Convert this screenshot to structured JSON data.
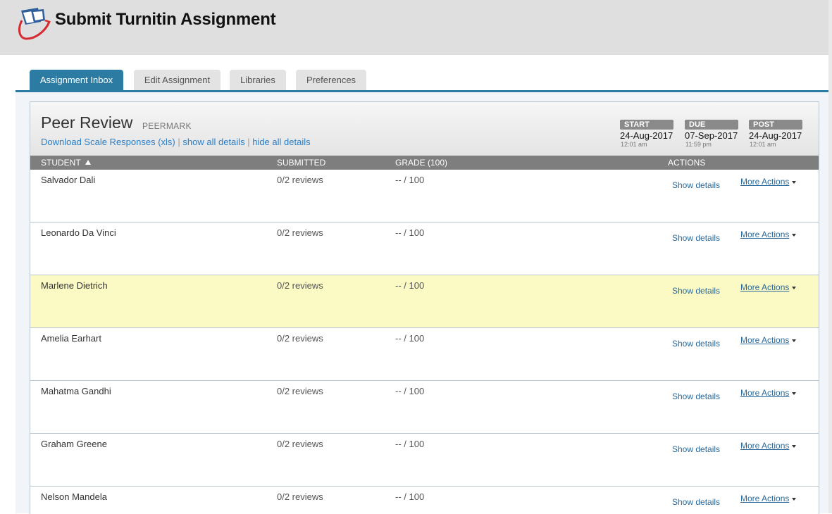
{
  "header": {
    "title": "Submit Turnitin Assignment",
    "logo_icon": "turnitin-logo-icon"
  },
  "tabs": [
    {
      "label": "Assignment Inbox",
      "active": true
    },
    {
      "label": "Edit Assignment",
      "active": false
    },
    {
      "label": "Libraries",
      "active": false
    },
    {
      "label": "Preferences",
      "active": false
    }
  ],
  "assignment": {
    "title": "Peer Review",
    "type": "PEERMARK",
    "links": {
      "download": "Download Scale Responses (xls)",
      "separator": "|",
      "show_all": "show all details",
      "hide_all": "hide all details"
    },
    "dates": {
      "start": {
        "label": "START",
        "date": "24-Aug-2017",
        "time": "12:01 am"
      },
      "due": {
        "label": "DUE",
        "date": "07-Sep-2017",
        "time": "11:59 pm"
      },
      "post": {
        "label": "POST",
        "date": "24-Aug-2017",
        "time": "12:01 am"
      }
    }
  },
  "table": {
    "columns": {
      "student": "STUDENT",
      "submitted": "SUBMITTED",
      "grade": "GRADE (100)",
      "actions": "ACTIONS"
    },
    "sort": {
      "column": "student",
      "direction": "ascending"
    },
    "show_details_label": "Show details",
    "more_actions_label": "More Actions",
    "rows": [
      {
        "student": "Salvador Dali",
        "submitted": "0/2 reviews",
        "grade": "-- / 100",
        "highlighted": false
      },
      {
        "student": "Leonardo Da Vinci",
        "submitted": "0/2 reviews",
        "grade": "-- / 100",
        "highlighted": false
      },
      {
        "student": "Marlene Dietrich",
        "submitted": "0/2 reviews",
        "grade": "-- / 100",
        "highlighted": true
      },
      {
        "student": "Amelia Earhart",
        "submitted": "0/2 reviews",
        "grade": "-- / 100",
        "highlighted": false
      },
      {
        "student": "Mahatma Gandhi",
        "submitted": "0/2 reviews",
        "grade": "-- / 100",
        "highlighted": false
      },
      {
        "student": "Graham Greene",
        "submitted": "0/2 reviews",
        "grade": "-- / 100",
        "highlighted": false
      },
      {
        "student": "Nelson Mandela",
        "submitted": "0/2 reviews",
        "grade": "-- / 100",
        "highlighted": false
      }
    ]
  },
  "colors": {
    "tab_active": "#2c7ba2",
    "link": "#2b7fc8",
    "row_highlight": "#fbfac5",
    "column_header": "#7e7e7e"
  }
}
